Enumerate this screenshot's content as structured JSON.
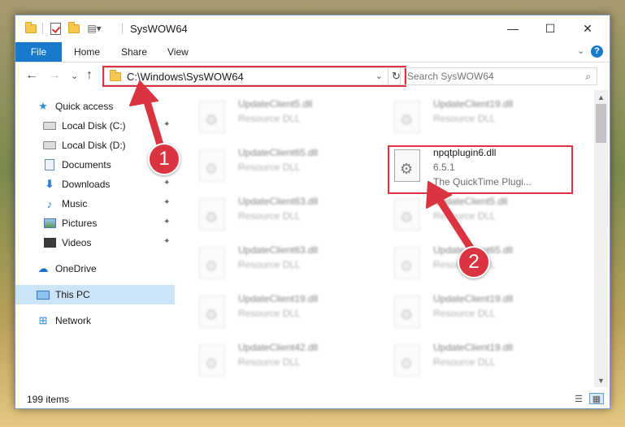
{
  "titlebar": {
    "title": "SysWOW64",
    "minimize": "—",
    "maximize": "☐",
    "close": "✕",
    "quick_access_icons": [
      "folder-icon",
      "properties-icon",
      "new-folder-icon",
      "customize-icon"
    ]
  },
  "ribbon": {
    "tabs": [
      "File",
      "Home",
      "Share",
      "View"
    ],
    "expand": "⌄",
    "help": "?"
  },
  "navigation": {
    "back": "←",
    "forward": "→",
    "recent": "⌄",
    "up": "↑",
    "address": "C:\\Windows\\SysWOW64",
    "address_dropdown": "⌄",
    "refresh": "↻",
    "search_placeholder": "Search SysWOW64",
    "search_icon": "⌕"
  },
  "sidebar": {
    "items": [
      {
        "label": "Quick access",
        "icon": "star-icon",
        "pinned": false
      },
      {
        "label": "Local Disk (C:)",
        "icon": "disk-icon",
        "pinned": true
      },
      {
        "label": "Local Disk (D:)",
        "icon": "disk-icon",
        "pinned": false
      },
      {
        "label": "Documents",
        "icon": "documents-icon",
        "pinned": true
      },
      {
        "label": "Downloads",
        "icon": "download-icon",
        "pinned": true
      },
      {
        "label": "Music",
        "icon": "music-icon",
        "pinned": true
      },
      {
        "label": "Pictures",
        "icon": "pictures-icon",
        "pinned": true
      },
      {
        "label": "Videos",
        "icon": "videos-icon",
        "pinned": true
      },
      {
        "label": "OneDrive",
        "icon": "cloud-icon",
        "pinned": false
      },
      {
        "label": "This PC",
        "icon": "computer-icon",
        "pinned": false,
        "selected": true
      },
      {
        "label": "Network",
        "icon": "network-icon",
        "pinned": false
      }
    ],
    "pin_glyph": "📌"
  },
  "files": {
    "left_column": [
      {
        "name": "UpdateClient5.dll",
        "type": "Resource DLL"
      },
      {
        "name": "UpdateClient65.dll",
        "type": "Resource DLL"
      },
      {
        "name": "UpdateClient63.dll",
        "type": "Resource DLL"
      },
      {
        "name": "UpdateClient63.dll",
        "type": "Resource DLL"
      },
      {
        "name": "UpdateClient19.dll",
        "type": "Resource DLL"
      },
      {
        "name": "UpdateClient42.dll",
        "type": "Resource DLL"
      }
    ],
    "right_column": [
      {
        "name": "UpdateClient19.dll",
        "type": "Resource DLL"
      },
      {
        "name": "npqtplugin6.dll",
        "type": "6.5.1",
        "description": "The QuickTime Plugi...",
        "highlighted": true
      },
      {
        "name": "UpdateClient5.dll",
        "type": "Resource DLL"
      },
      {
        "name": "UpdateClient65.dll",
        "type": "Resource DLL"
      },
      {
        "name": "UpdateClient19.dll",
        "type": "Resource DLL"
      },
      {
        "name": "UpdateClient19.dll",
        "type": "Resource DLL"
      }
    ]
  },
  "status": {
    "item_count": "199 items",
    "view_details_icon": "details-view-icon",
    "view_tiles_icon": "large-icons-view-icon"
  },
  "callouts": {
    "step1": "1",
    "step2": "2",
    "color": "#d9343f"
  },
  "scrollbar": {
    "up": "▲",
    "down": "▼"
  },
  "colors": {
    "accent": "#1979ca",
    "selection": "#cce4f7",
    "highlight_red": "#d9343f"
  }
}
